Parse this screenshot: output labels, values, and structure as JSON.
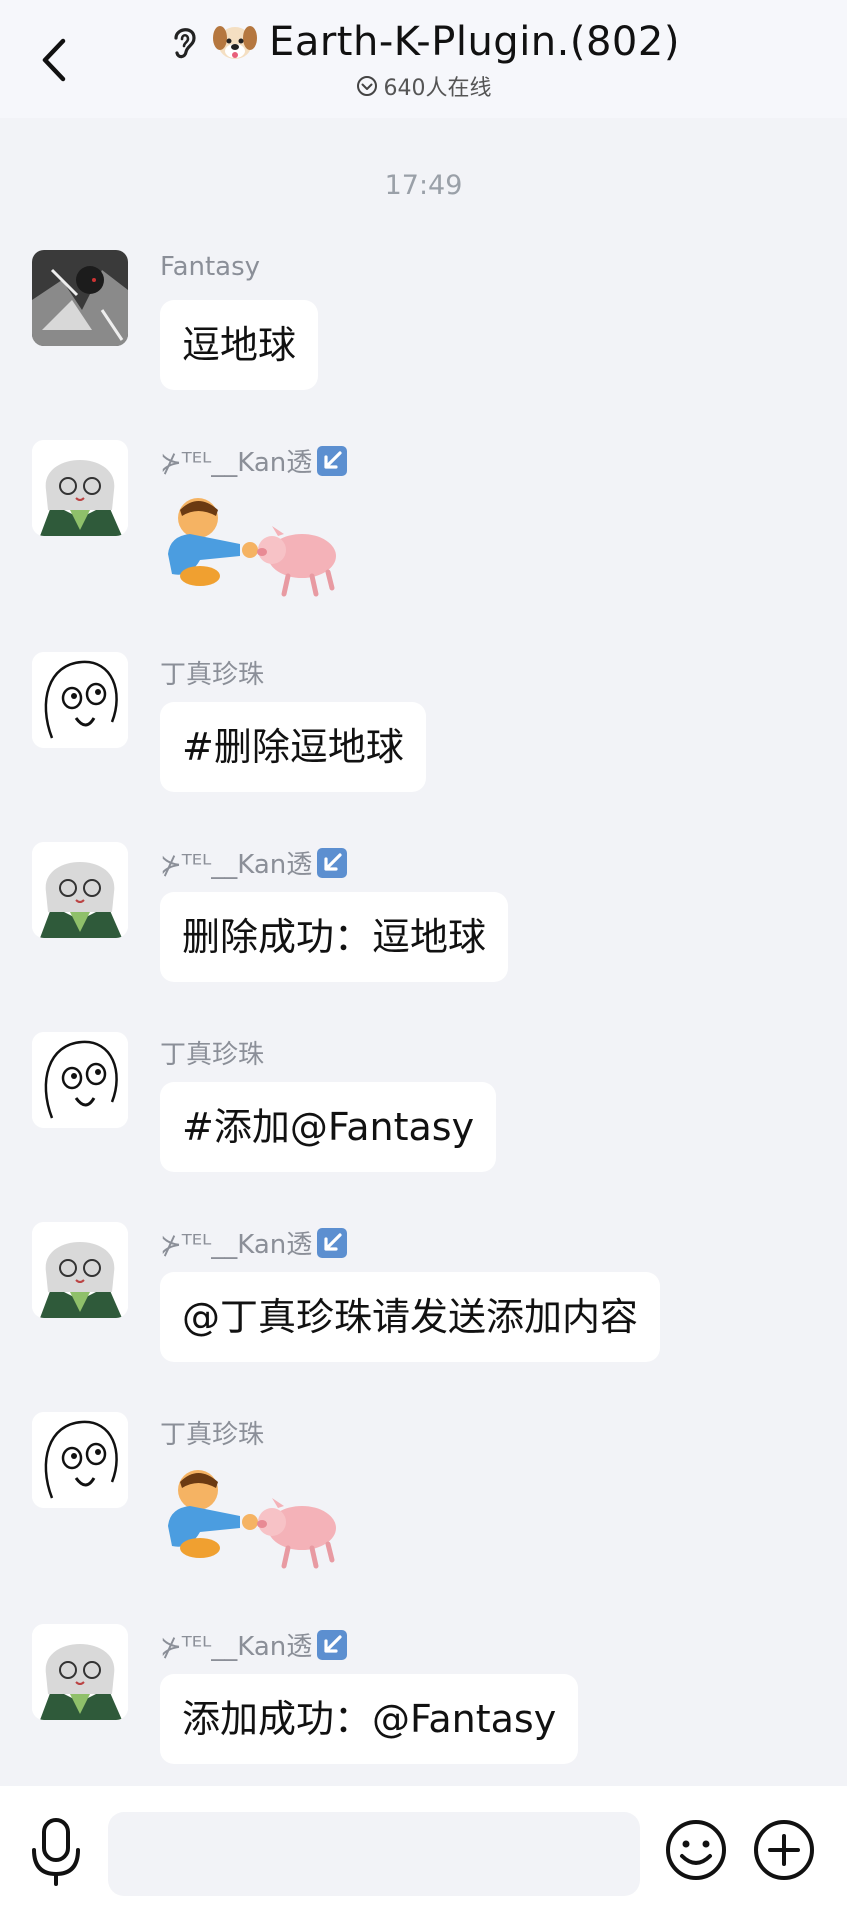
{
  "header": {
    "title": "Earth-K-Plugin.(802)",
    "online": "640人在线"
  },
  "timestamp": "17:49",
  "messages": [
    {
      "sender": "Fantasy",
      "type": "text",
      "text": "逗地球"
    },
    {
      "sender": "⊁ᵀᴱᴸ__Kan透",
      "type": "sticker"
    },
    {
      "sender": "丁真珍珠",
      "type": "text",
      "text": "#删除逗地球"
    },
    {
      "sender": "⊁ᵀᴱᴸ__Kan透",
      "type": "text",
      "text": "删除成功：逗地球"
    },
    {
      "sender": "丁真珍珠",
      "type": "text",
      "text": "#添加@Fantasy"
    },
    {
      "sender": "⊁ᵀᴱᴸ__Kan透",
      "type": "text",
      "text": "@丁真珍珠请发送添加内容"
    },
    {
      "sender": "丁真珍珠",
      "type": "sticker"
    },
    {
      "sender": "⊁ᵀᴱᴸ__Kan透",
      "type": "text",
      "text": "添加成功：@Fantasy"
    }
  ],
  "input": {
    "placeholder": ""
  },
  "colors": {
    "background": "#f2f3f7",
    "bubble": "#ffffff",
    "badge": "#4a7fc1"
  }
}
